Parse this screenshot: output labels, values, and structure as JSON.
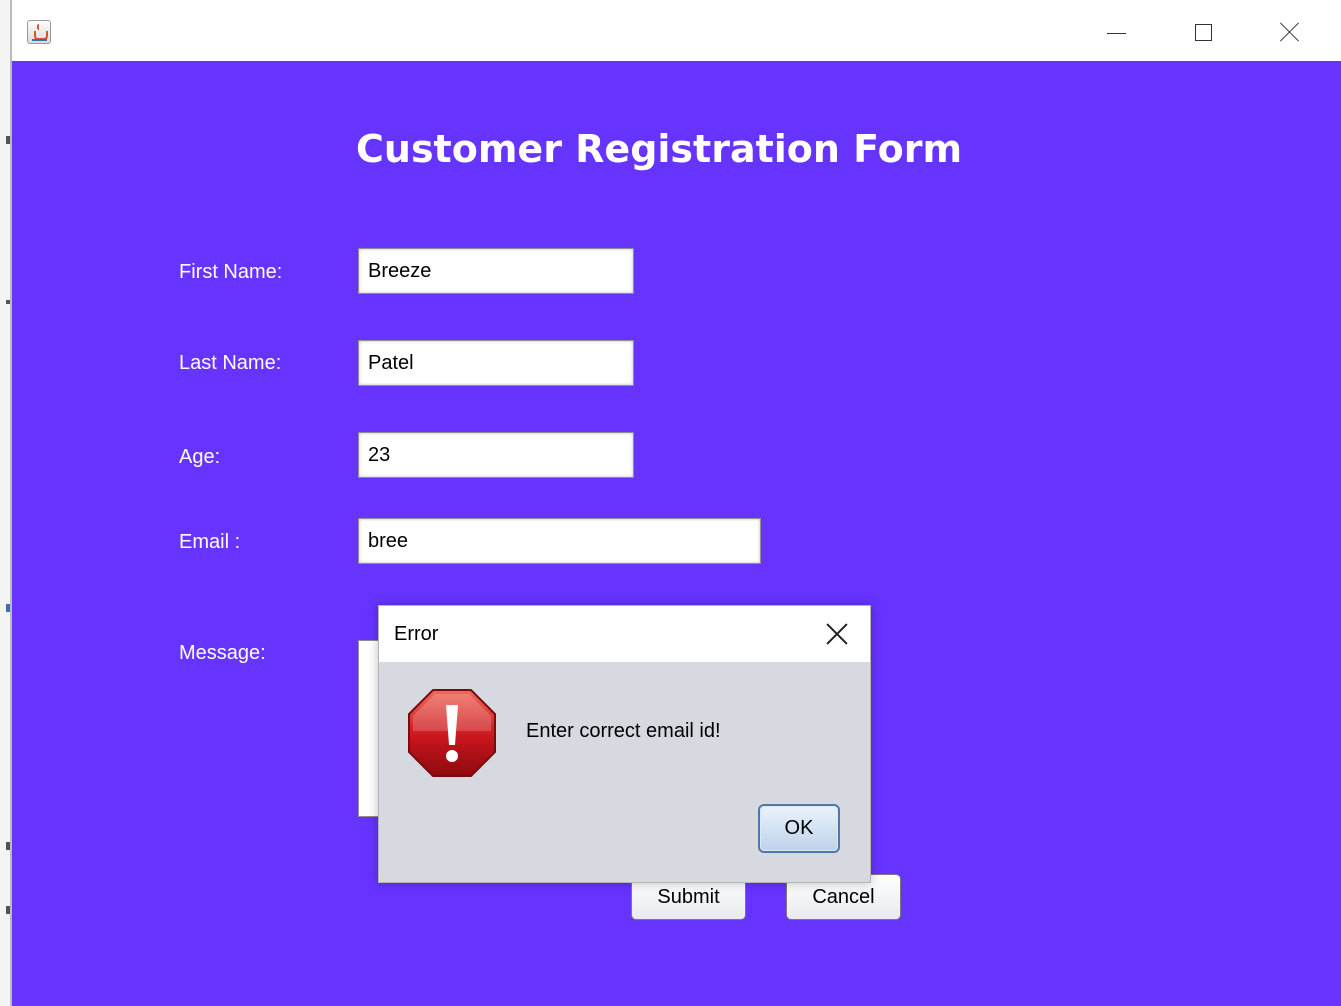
{
  "window": {
    "icon": "java-cup-icon",
    "controls": {
      "minimize": "minimize-icon",
      "maximize": "maximize-icon",
      "close": "close-icon"
    }
  },
  "form": {
    "title": "Customer Registration Form",
    "fields": {
      "first_name": {
        "label": "First Name:",
        "value": "Breeze"
      },
      "last_name": {
        "label": "Last Name:",
        "value": "Patel"
      },
      "age": {
        "label": "Age:",
        "value": "23"
      },
      "email": {
        "label": "Email :",
        "value": "bree"
      },
      "message": {
        "label": "Message:",
        "value": ""
      }
    },
    "buttons": {
      "submit": "Submit",
      "cancel": "Cancel"
    },
    "background_color": "#6633ff"
  },
  "dialog": {
    "title": "Error",
    "icon": "error-octagon-icon",
    "message": "Enter correct email id!",
    "ok_label": "OK"
  }
}
